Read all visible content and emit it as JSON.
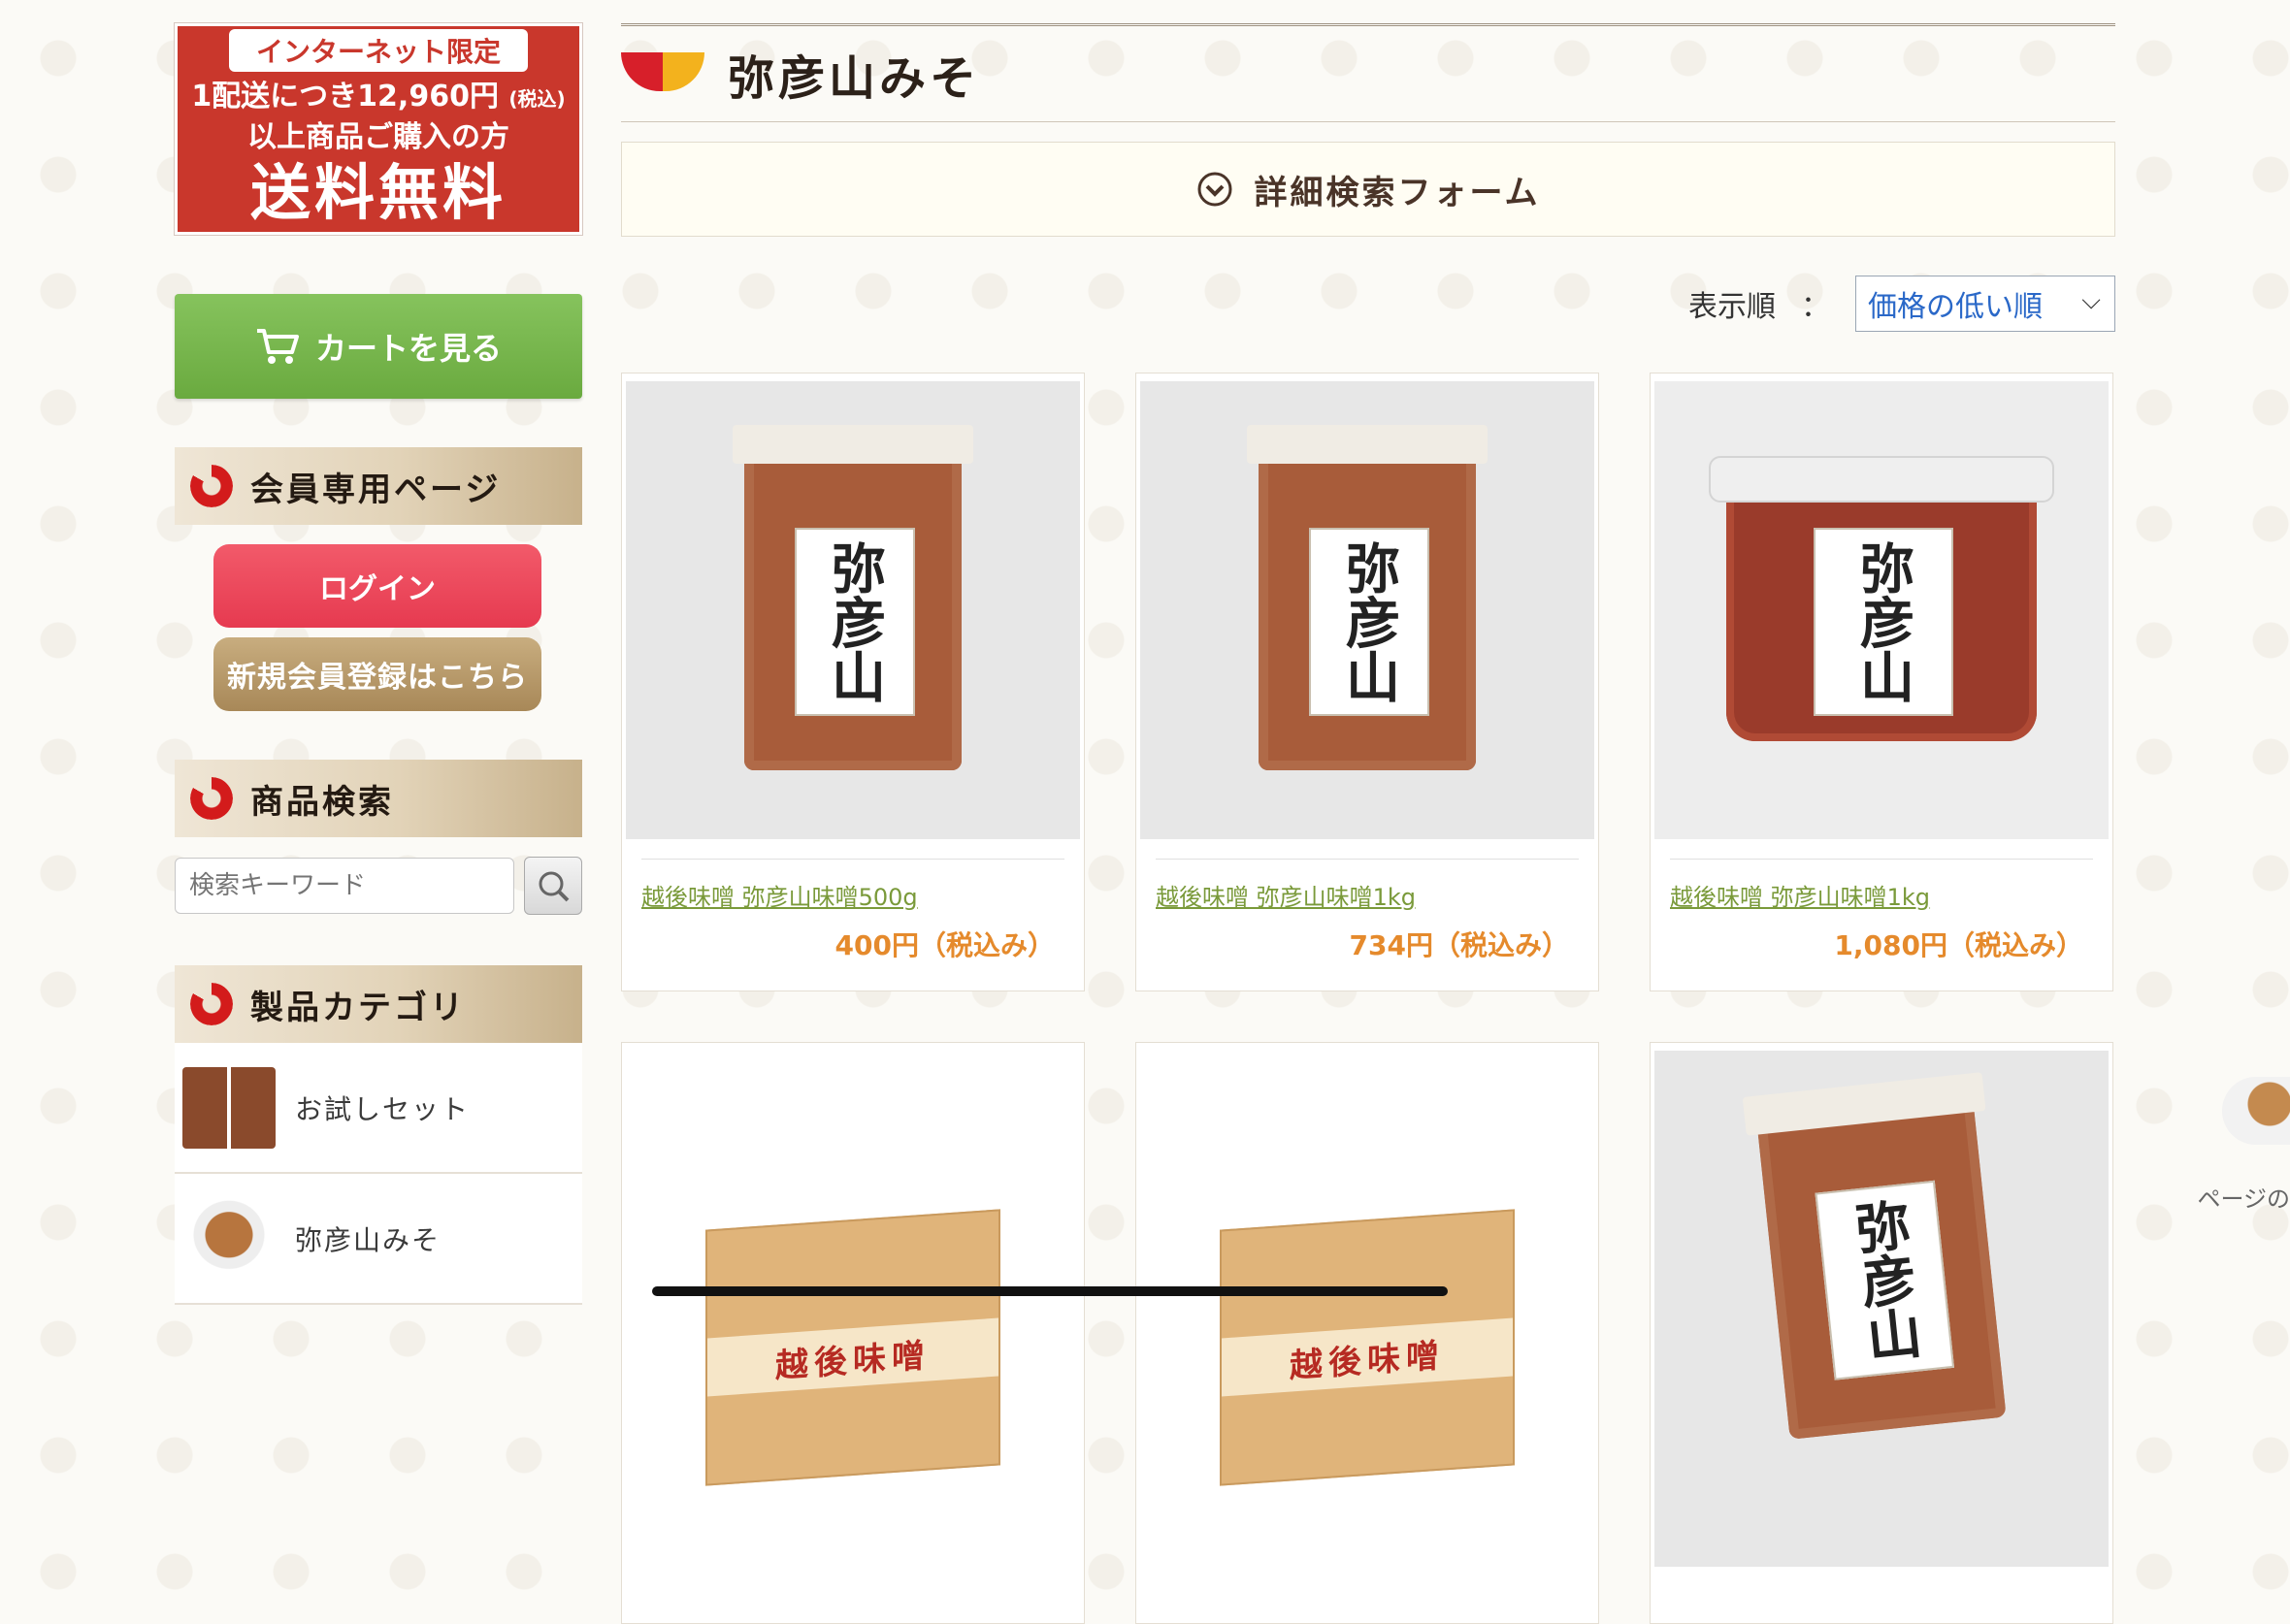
{
  "banner": {
    "line1": "インターネット限定",
    "line2a": "1配送につき12,960円",
    "line2b": "(税込)",
    "line3": "以上商品ご購入の方",
    "line4": "送料無料"
  },
  "sidebar": {
    "cart_label": "カートを見る",
    "member_heading": "会員専用ページ",
    "login_label": "ログイン",
    "register_label": "新規会員登録はこちら",
    "search_heading": "商品検索",
    "search_placeholder": "検索キーワード",
    "category_heading": "製品カテゴリ",
    "categories": [
      {
        "label": "お試しセット",
        "icon": "trial-set-thumb"
      },
      {
        "label": "弥彦山みそ",
        "icon": "miso-bowl-thumb"
      }
    ]
  },
  "main": {
    "page_title": "弥彦山みそ",
    "adv_search_label": "詳細検索フォーム",
    "sort_label": "表示順",
    "sort_colon": "：",
    "sort_selected": "価格の低い順"
  },
  "products": [
    {
      "name": "越後味噌 弥彦山味噌500g",
      "price": "400円（税込み）",
      "label": "弥彦山"
    },
    {
      "name": "越後味噌 弥彦山味噌1kg",
      "price": "734円（税込み）",
      "label": "弥彦山"
    },
    {
      "name": "越後味噌 弥彦山味噌1kg",
      "price": "1,080円（税込み）",
      "label": "弥彦山"
    }
  ],
  "lower_products": [
    {
      "band": "越後味噌"
    },
    {
      "band": "越後味噌"
    },
    {
      "label": "弥彦山"
    }
  ],
  "page_top_text": "ページの",
  "colors": {
    "accent_red": "#c9372c",
    "cart_green": "#6aaa3f",
    "price_orange": "#e58a2c",
    "link_green": "#7a9a3a"
  }
}
